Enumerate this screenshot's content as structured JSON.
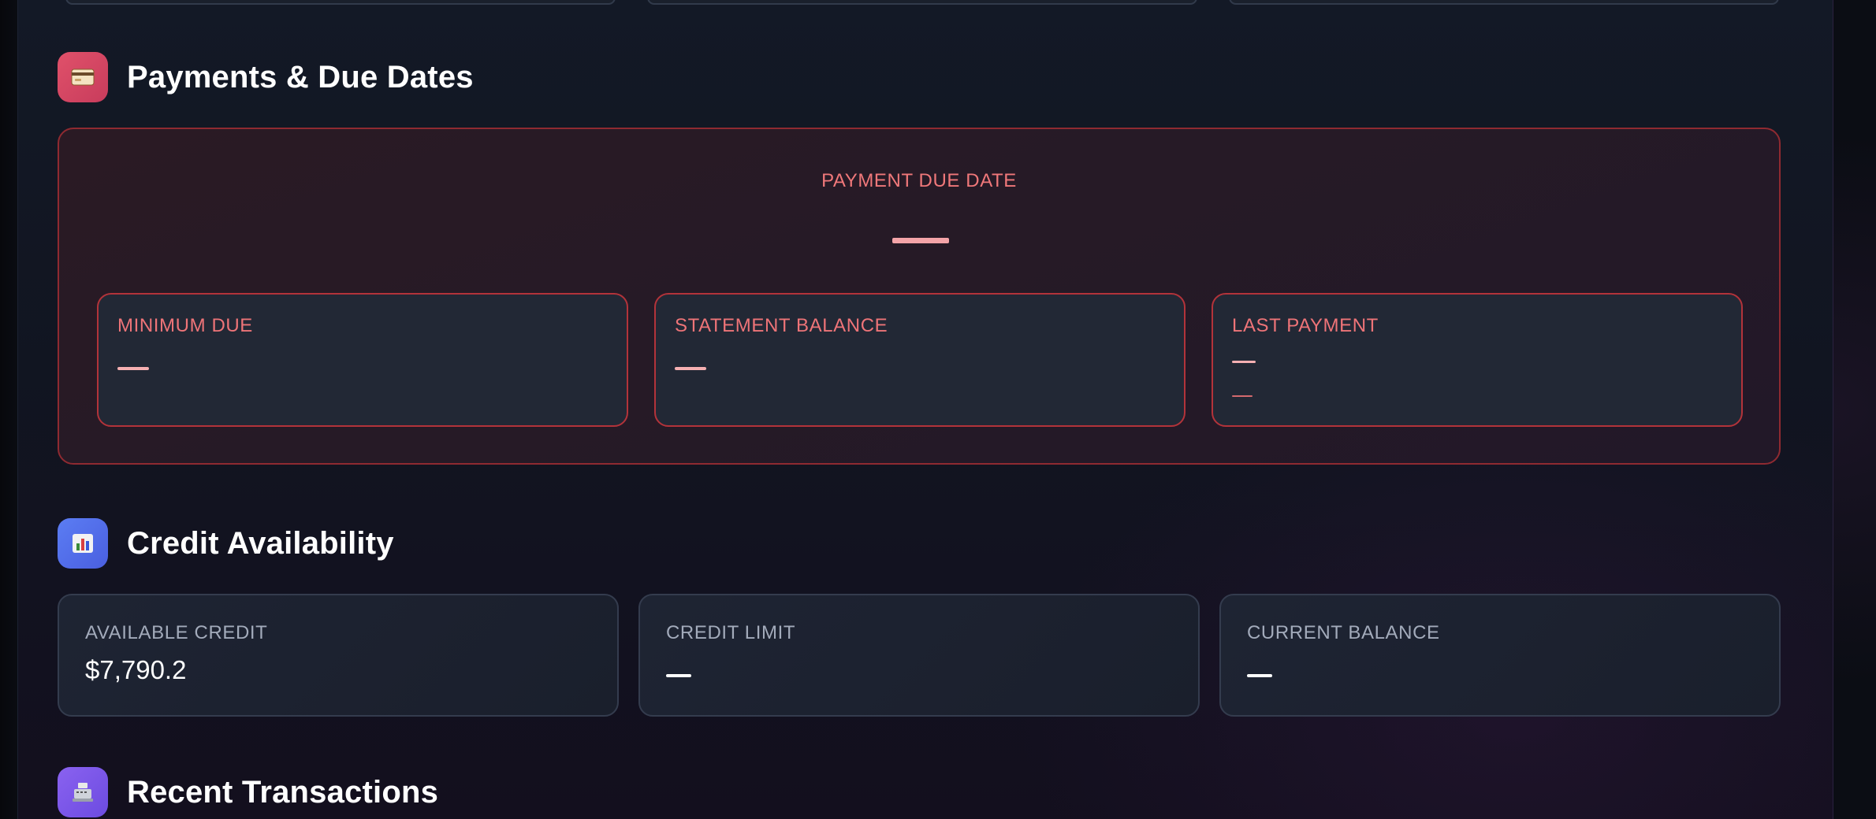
{
  "payments": {
    "title": "Payments & Due Dates",
    "icon": "credit-card-icon",
    "due_date_label": "PAYMENT DUE DATE",
    "due_date_value": "—",
    "cards": [
      {
        "label": "MINIMUM DUE",
        "value": "—"
      },
      {
        "label": "STATEMENT BALANCE",
        "value": "—"
      },
      {
        "label": "LAST PAYMENT",
        "value": "—",
        "subvalue": "—"
      }
    ]
  },
  "credit": {
    "title": "Credit Availability",
    "icon": "bar-chart-icon",
    "cards": [
      {
        "label": "AVAILABLE CREDIT",
        "value": "$7,790.2"
      },
      {
        "label": "CREDIT LIMIT",
        "value": "—"
      },
      {
        "label": "CURRENT BALANCE",
        "value": "—"
      }
    ]
  },
  "transactions": {
    "title": "Recent Transactions",
    "icon": "cash-register-icon"
  },
  "colors": {
    "accent_red": "#f0787a",
    "accent_blue": "#5b7df3",
    "accent_purple": "#8a62f0"
  }
}
